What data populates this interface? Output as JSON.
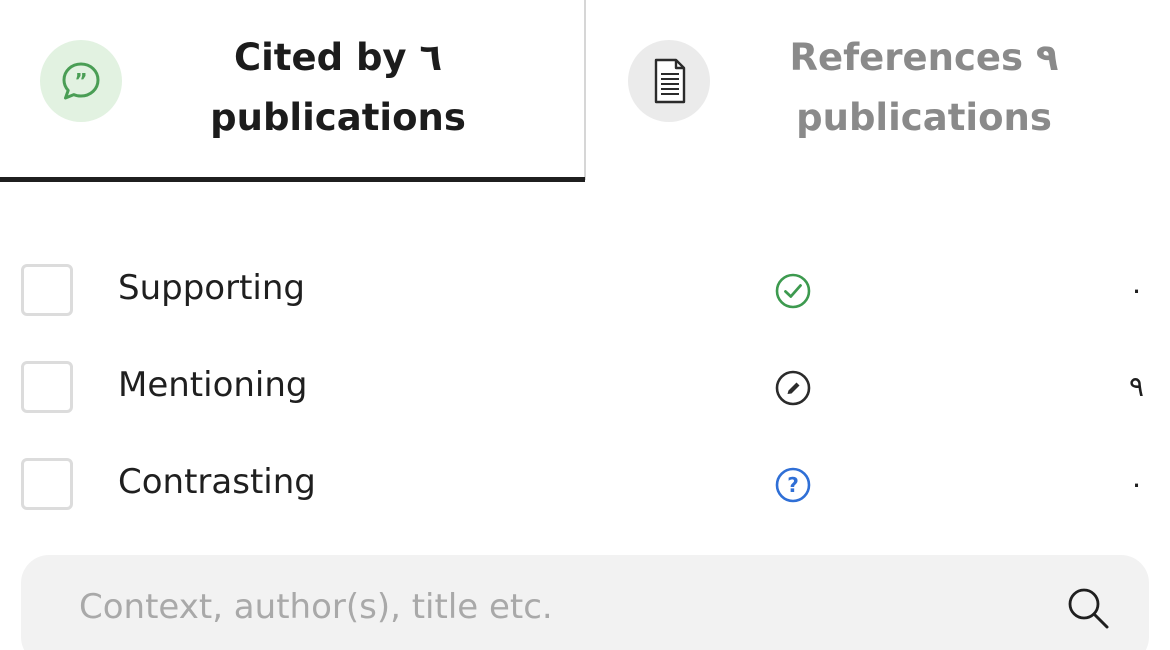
{
  "tabs": {
    "cited": {
      "line1": "Cited by ٦",
      "line2": "publications",
      "icon": "speech-bubble-quote-icon",
      "active": true,
      "accent": "#4a9e55"
    },
    "references": {
      "line1": "References ٩",
      "line2": "publications",
      "icon": "document-icon",
      "active": false
    }
  },
  "filters": [
    {
      "label": "Supporting",
      "count": "٠",
      "icon": "check-circle-icon",
      "color": "#3d9a4f",
      "checked": false
    },
    {
      "label": "Mentioning",
      "count": "٩",
      "icon": "slash-circle-icon",
      "color": "#2b2b2b",
      "checked": false
    },
    {
      "label": "Contrasting",
      "count": "٠",
      "icon": "question-circle-icon",
      "color": "#2f6fd6",
      "checked": false
    }
  ],
  "search": {
    "placeholder": "Context, author(s), title etc.",
    "value": "",
    "icon": "search-icon"
  }
}
